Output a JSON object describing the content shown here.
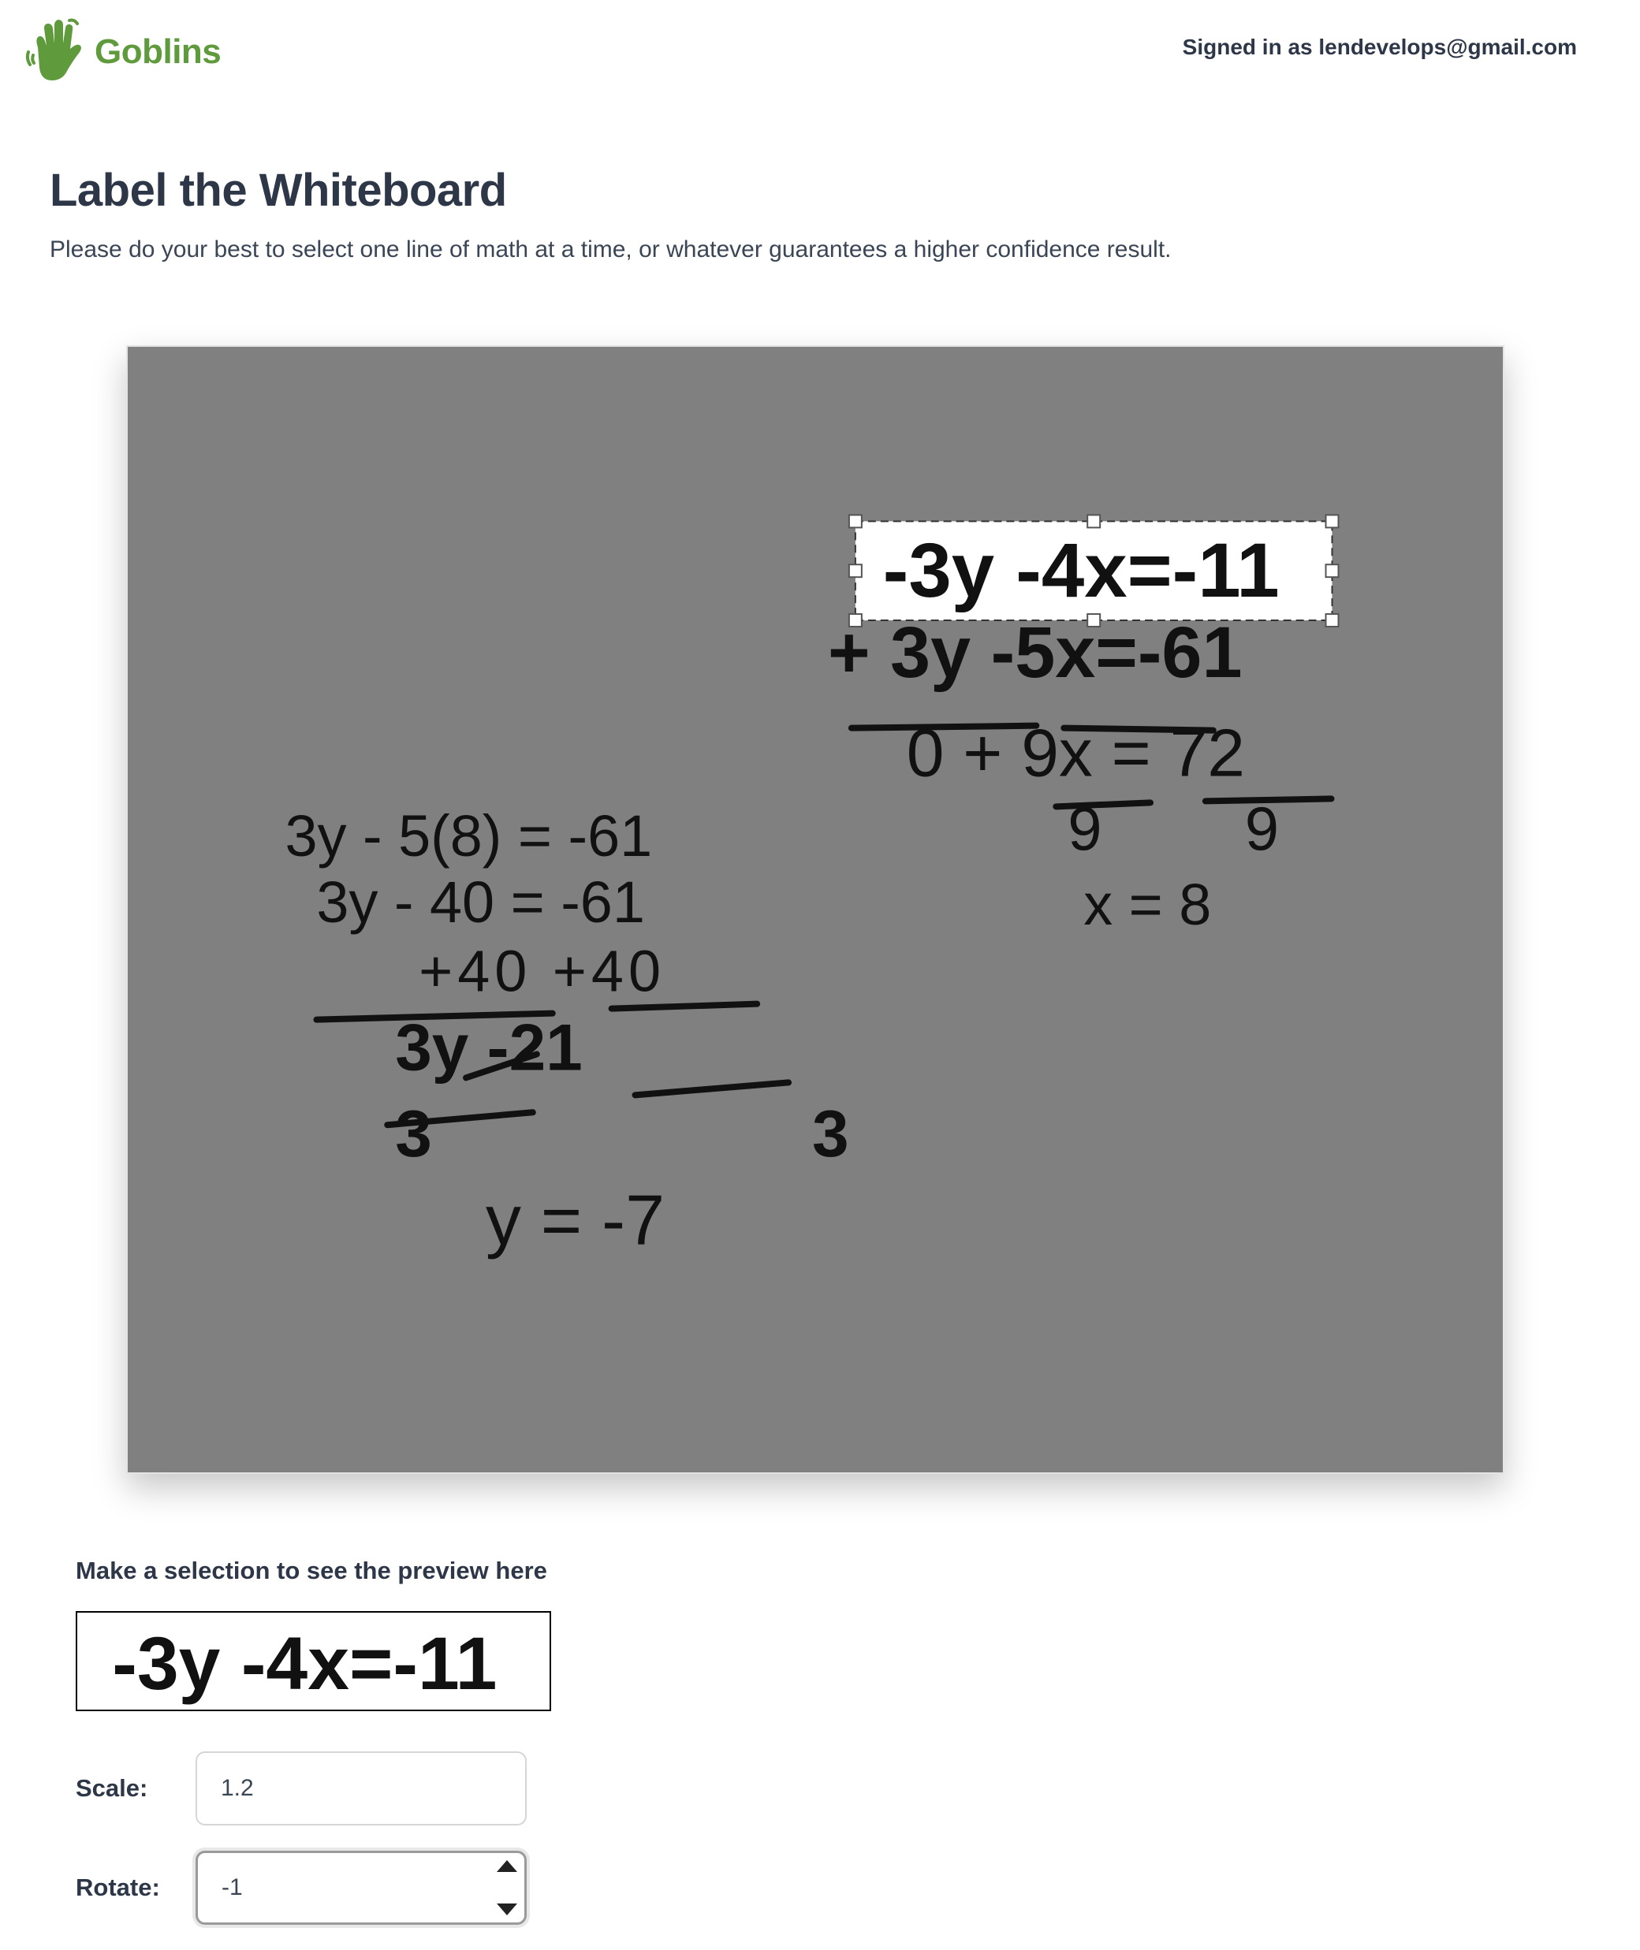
{
  "header": {
    "logo_text": "Goblins",
    "logo_icon": "waving-hand-icon",
    "signed_in_text": "Signed in as lendevelops@gmail.com",
    "brand_color": "#5f9a3c"
  },
  "page": {
    "title": "Label the Whiteboard",
    "subtitle": "Please do your best to select one line of math at a time, or whatever guarantees a higher confidence result."
  },
  "whiteboard": {
    "background_color": "#808080",
    "lines": [
      "-3y -4x=-11",
      "+ 3y -5x=-61",
      "0 + 9x = 72",
      "9 9",
      "x = 8",
      "3y - 5(8) = -61",
      "3y - 40 = -61",
      "+40 +40",
      "3y -21",
      "3 3",
      "y = -7"
    ],
    "selected_line": "-3y -4x=-11"
  },
  "preview": {
    "label": "Make a selection to see the preview here",
    "content": "-3y -4x=-11"
  },
  "controls": {
    "scale_label": "Scale:",
    "scale_value": "1.2",
    "rotate_label": "Rotate:",
    "rotate_value": "-1"
  }
}
